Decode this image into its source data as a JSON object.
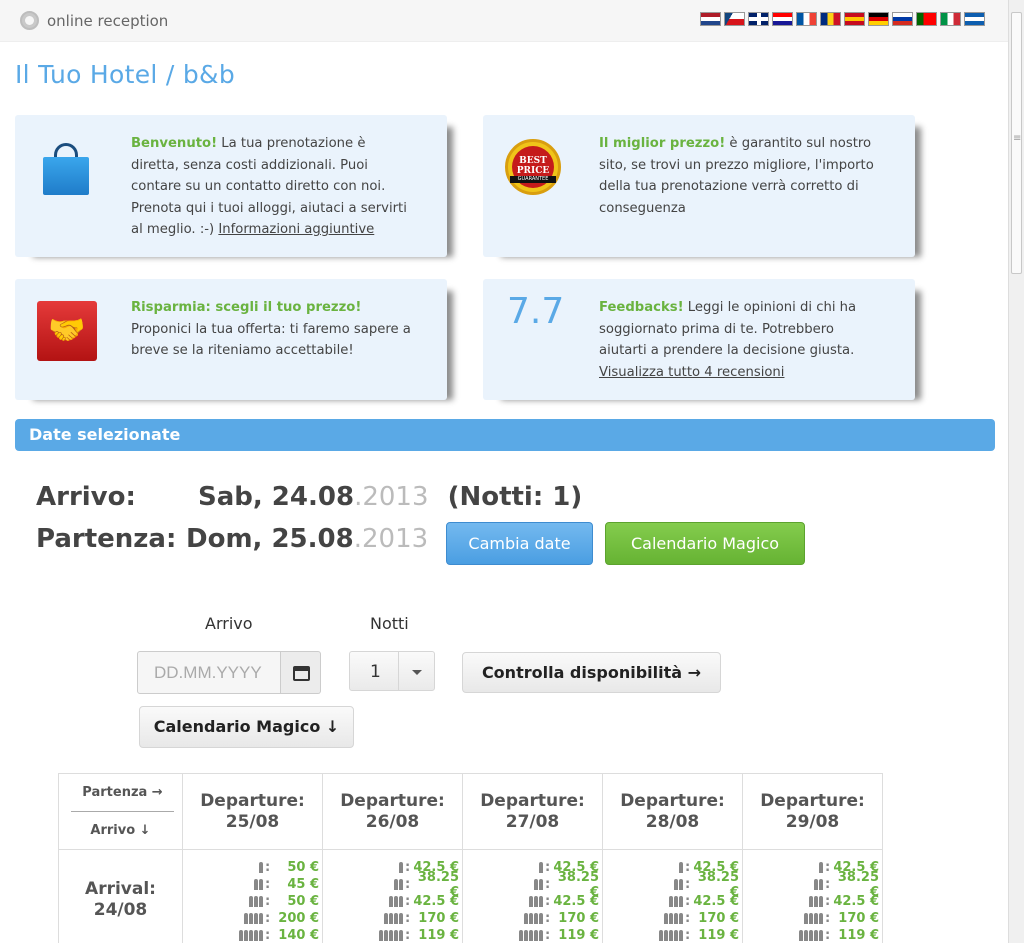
{
  "topbar": {
    "brand": "online reception",
    "languages": [
      {
        "code": "nl",
        "colors": [
          "#ae1c28",
          "#ffffff",
          "#21468b"
        ],
        "dir": "h"
      },
      {
        "code": "cs",
        "colors": [
          "#ffffff",
          "#d7141a",
          "#11457e"
        ],
        "dir": "cz"
      },
      {
        "code": "en",
        "colors": [
          "#012169",
          "#ffffff",
          "#c8102e"
        ],
        "dir": "uk"
      },
      {
        "code": "hr",
        "colors": [
          "#ff0000",
          "#ffffff",
          "#171796"
        ],
        "dir": "h"
      },
      {
        "code": "fr",
        "colors": [
          "#0055a4",
          "#ffffff",
          "#ef4135"
        ],
        "dir": "v"
      },
      {
        "code": "ro",
        "colors": [
          "#002b7f",
          "#fcd116",
          "#ce1126"
        ],
        "dir": "v"
      },
      {
        "code": "es",
        "colors": [
          "#c60b1e",
          "#ffc400",
          "#c60b1e"
        ],
        "dir": "h"
      },
      {
        "code": "de",
        "colors": [
          "#000000",
          "#dd0000",
          "#ffce00"
        ],
        "dir": "h"
      },
      {
        "code": "ru",
        "colors": [
          "#ffffff",
          "#0039a6",
          "#d52b1e"
        ],
        "dir": "h"
      },
      {
        "code": "pt",
        "colors": [
          "#006600",
          "#ff0000",
          "#ff0000"
        ],
        "dir": "v"
      },
      {
        "code": "it",
        "colors": [
          "#009246",
          "#ffffff",
          "#ce2b37"
        ],
        "dir": "v"
      },
      {
        "code": "el",
        "colors": [
          "#0d5eaf",
          "#ffffff",
          "#0d5eaf"
        ],
        "dir": "h"
      }
    ]
  },
  "hotel_title": "Il Tuo Hotel / b&b",
  "cards": {
    "welcome": {
      "lead": "Benvenuto!",
      "text": " La tua prenotazione è diretta, senza costi addizionali. Puoi contare su un contatto diretto con noi. Prenota qui i tuoi alloggi, aiutaci a servirti al meglio. :-) ",
      "link": "Informazioni aggiuntive"
    },
    "best_price": {
      "lead": "Il miglior prezzo!",
      "text": " è garantito sul nostro sito, se trovi un prezzo migliore, l'importo della tua prenotazione verrà corretto di conseguenza",
      "badge_top": "BEST PRICE",
      "badge_ribbon": "GUARANTEE"
    },
    "save": {
      "lead": "Risparmia: scegli il tuo prezzo!",
      "text": "Proponici la tua offerta: ti faremo sapere a breve se la riteniamo accettabile!"
    },
    "feedback": {
      "score": "7.7",
      "lead": "Feedbacks!",
      "text": " Leggi le opinioni di chi ha soggiornato prima di te. Potrebbero aiutarti a prendere la decisione giusta. ",
      "link": "Visualizza tutto 4 recensioni"
    }
  },
  "section_title": "Date selezionate",
  "selected": {
    "arrival_label": "Arrivo:",
    "arrival_date": "Sab, 24.08",
    "arrival_year": ".2013",
    "nights": "(Notti: 1)",
    "departure_label": "Partenza:",
    "departure_date": "Dom, 25.08",
    "departure_year": ".2013",
    "change_btn": "Cambia date",
    "magic_btn": "Calendario Magico"
  },
  "form": {
    "arrival_label": "Arrivo",
    "nights_label": "Notti",
    "date_placeholder": "DD.MM.YYYY",
    "nights_value": "1",
    "check_btn": "Controlla disponibilità →",
    "magic_btn": "Calendario Magico ↓"
  },
  "table": {
    "corner_top": "Partenza →",
    "corner_bottom": "Arrivo ↓",
    "columns": [
      "Departure:\n25/08",
      "Departure:\n26/08",
      "Departure:\n27/08",
      "Departure:\n28/08",
      "Departure:\n29/08"
    ],
    "row_label": "Arrival:\n24/08",
    "prices": [
      [
        "50 €",
        "45 €",
        "50 €",
        "200 €",
        "140 €"
      ],
      [
        "42.5 €",
        "38.25 €",
        "42.5 €",
        "170 €",
        "119 €"
      ],
      [
        "42.5 €",
        "38.25 €",
        "42.5 €",
        "170 €",
        "119 €"
      ],
      [
        "42.5 €",
        "38.25 €",
        "42.5 €",
        "170 €",
        "119 €"
      ],
      [
        "42.5 €",
        "38.25 €",
        "42.5 €",
        "170 €",
        "119 €"
      ]
    ],
    "occupancy": [
      1,
      2,
      3,
      4,
      5
    ]
  }
}
